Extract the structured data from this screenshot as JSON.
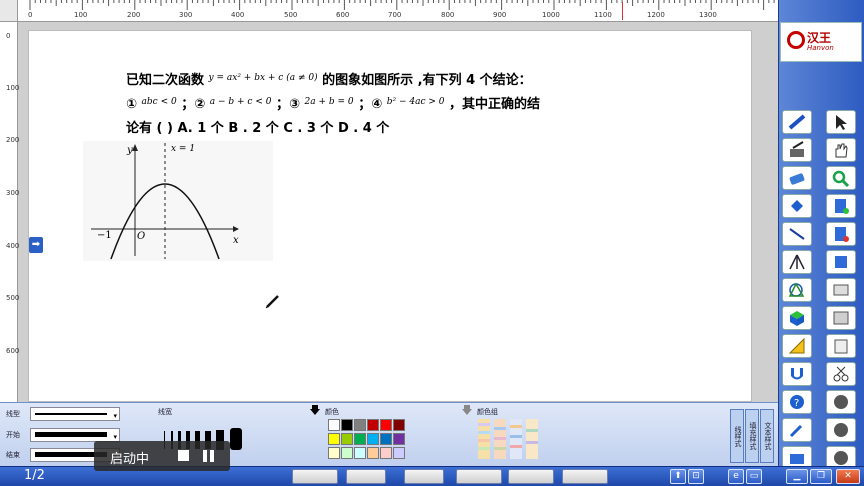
{
  "ruler": {
    "top_labels": [
      "0",
      "100",
      "200",
      "300",
      "400",
      "500",
      "600",
      "700",
      "800",
      "900",
      "1000",
      "1100",
      "1200",
      "1300"
    ],
    "left_labels": [
      "0",
      "100",
      "200",
      "300",
      "400",
      "500",
      "600"
    ]
  },
  "question": {
    "line1_prefix": "已知二次函数",
    "line1_formula": "y = ax² + bx + c (a ≠ 0)",
    "line1_suffix": "的图象如图所示 ,有下列 4 个结论：",
    "c1_num": "①",
    "c1": "abc < 0",
    "c2_num": "；②",
    "c2": "a − b + c < 0",
    "c3_num": "；③",
    "c3": "2a + b = 0",
    "c4_num": "；④",
    "c4": "b² − 4ac > 0",
    "line2_suffix": "，其中正确的结",
    "line3": "论有 (      ) A. 1 个     B . 2 个     C . 3 个       D . 4 个"
  },
  "graph": {
    "y_label": "y",
    "x_label": "x",
    "axis_line_label": "x = 1",
    "origin_label": "O",
    "neg_one_label": "−1"
  },
  "logo": {
    "name": "汉王",
    "sub": "Hanvon"
  },
  "props": {
    "line_type_label": "线型",
    "start_label": "开始",
    "end_label": "结束",
    "line_width_label": "线宽",
    "color_label": "颜色",
    "color_group_label": "颜色组",
    "tab_line_style": "线样式",
    "tab_fill_style": "填充样式",
    "tab_text_style": "文本样式"
  },
  "colors": {
    "palette": [
      "#ffffff",
      "#000000",
      "#808080",
      "#c00000",
      "#ff0000",
      "#800000",
      "#ffff00",
      "#99cc00",
      "#00b050",
      "#00b0f0",
      "#0070c0",
      "#7030a0",
      "#ffffcc",
      "#ccffcc",
      "#ccffff",
      "#ffcc99",
      "#ffcccc",
      "#ccccff"
    ]
  },
  "status": {
    "page": "1/2"
  },
  "overlay": {
    "label": "启动中"
  }
}
